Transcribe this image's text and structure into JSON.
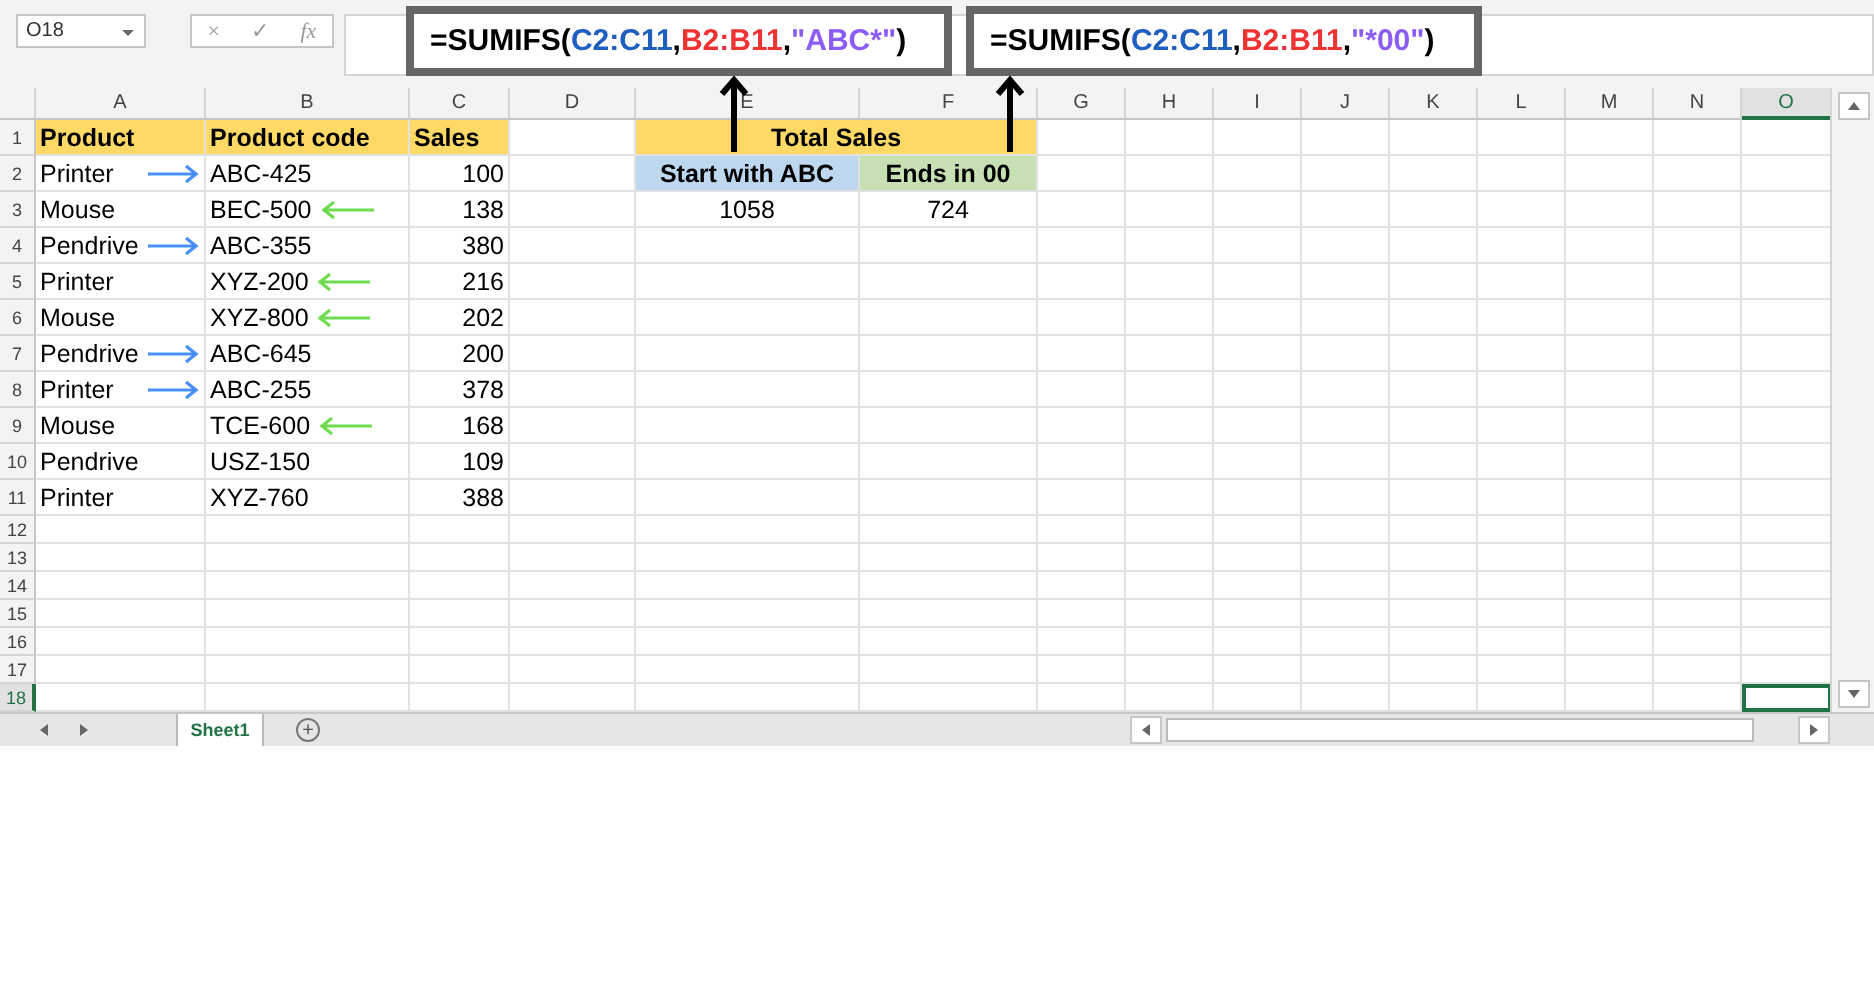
{
  "name_box": "O18",
  "formula_icons": [
    "×",
    "✓",
    "fx"
  ],
  "callouts": [
    {
      "parts": [
        {
          "text": "=SUMIFS(",
          "color": "#000000"
        },
        {
          "text": "C2:C11",
          "color": "#1f5fbf"
        },
        {
          "text": ",",
          "color": "#000000"
        },
        {
          "text": "B2:B11",
          "color": "#ee3333"
        },
        {
          "text": ",",
          "color": "#000000"
        },
        {
          "text": "\"ABC*\"",
          "color": "#8b5cf6"
        },
        {
          "text": ")",
          "color": "#000000"
        }
      ]
    },
    {
      "parts": [
        {
          "text": "=SUMIFS(",
          "color": "#000000"
        },
        {
          "text": "C2:C11",
          "color": "#1f5fbf"
        },
        {
          "text": ",",
          "color": "#000000"
        },
        {
          "text": "B2:B11",
          "color": "#ee3333"
        },
        {
          "text": ",",
          "color": "#000000"
        },
        {
          "text": "\"*00\"",
          "color": "#8b5cf6"
        },
        {
          "text": ")",
          "color": "#000000"
        }
      ]
    }
  ],
  "columns": [
    {
      "label": "A",
      "selected": false
    },
    {
      "label": "B",
      "selected": false
    },
    {
      "label": "C",
      "selected": false
    },
    {
      "label": "D",
      "selected": false
    },
    {
      "label": "E",
      "selected": false
    },
    {
      "label": "F",
      "selected": false
    },
    {
      "label": "G",
      "selected": false
    },
    {
      "label": "H",
      "selected": false
    },
    {
      "label": "I",
      "selected": false
    },
    {
      "label": "J",
      "selected": false
    },
    {
      "label": "K",
      "selected": false
    },
    {
      "label": "L",
      "selected": false
    },
    {
      "label": "M",
      "selected": false
    },
    {
      "label": "N",
      "selected": false
    },
    {
      "label": "O",
      "selected": true
    }
  ],
  "row_headers": [
    {
      "label": "1",
      "selected": false
    },
    {
      "label": "2",
      "selected": false
    },
    {
      "label": "3",
      "selected": false
    },
    {
      "label": "4",
      "selected": false
    },
    {
      "label": "5",
      "selected": false
    },
    {
      "label": "6",
      "selected": false
    },
    {
      "label": "7",
      "selected": false
    },
    {
      "label": "8",
      "selected": false
    },
    {
      "label": "9",
      "selected": false
    },
    {
      "label": "10",
      "selected": false
    },
    {
      "label": "11",
      "selected": false
    },
    {
      "label": "12",
      "selected": false
    },
    {
      "label": "13",
      "selected": false
    },
    {
      "label": "14",
      "selected": false
    },
    {
      "label": "15",
      "selected": false
    },
    {
      "label": "16",
      "selected": false
    },
    {
      "label": "17",
      "selected": false
    },
    {
      "label": "18",
      "selected": true
    }
  ],
  "table": {
    "headers": [
      "Product",
      "Product code",
      "Sales"
    ],
    "rows": [
      {
        "product": "Printer",
        "code": "ABC-425",
        "sales": "100",
        "kind": "right-arrow"
      },
      {
        "product": "Mouse",
        "code": "BEC-500",
        "sales": "138",
        "kind": "left-arrow"
      },
      {
        "product": "Pendrive",
        "code": "ABC-355",
        "sales": "380",
        "kind": "right-arrow"
      },
      {
        "product": "Printer",
        "code": "XYZ-200",
        "sales": "216",
        "kind": "left-arrow"
      },
      {
        "product": "Mouse",
        "code": "XYZ-800",
        "sales": "202",
        "kind": "left-arrow"
      },
      {
        "product": "Pendrive",
        "code": "ABC-645",
        "sales": "200",
        "kind": "right-arrow"
      },
      {
        "product": "Printer",
        "code": "ABC-255",
        "sales": "378",
        "kind": "right-arrow"
      },
      {
        "product": "Mouse",
        "code": "TCE-600",
        "sales": "168",
        "kind": "left-arrow"
      },
      {
        "product": "Pendrive",
        "code": "USZ-150",
        "sales": "109",
        "kind": "plain"
      },
      {
        "product": "Printer",
        "code": "XYZ-760",
        "sales": "388",
        "kind": "plain"
      }
    ]
  },
  "summary": {
    "title": "Total Sales",
    "labels": [
      {
        "text": "Start with ABC",
        "color": "#bdd7ee"
      },
      {
        "text": "Ends in 00",
        "color": "#c6e0b4"
      }
    ],
    "values": [
      "1058",
      "724"
    ]
  },
  "sheet_tabs": [
    {
      "label": "Sheet1",
      "selected": true
    }
  ],
  "add_sheet": "+"
}
